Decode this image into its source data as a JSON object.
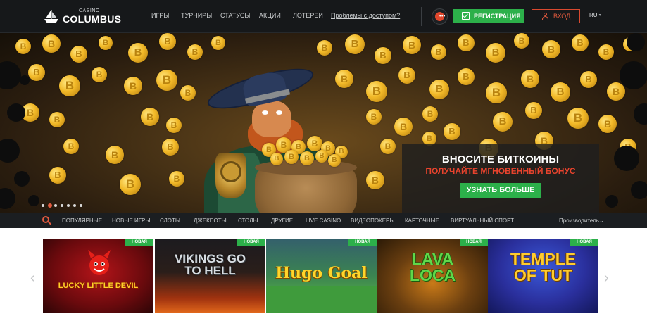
{
  "header": {
    "logo": {
      "small": "CASINO",
      "big": "COLUMBUS"
    },
    "nav": [
      {
        "label": "ИГРЫ"
      },
      {
        "label": "ТУРНИРЫ"
      },
      {
        "label": "СТАТУСЫ"
      },
      {
        "label": "АКЦИИ"
      },
      {
        "label": "ЛОТЕРЕИ"
      }
    ],
    "problem_link": "Проблемы с доступом?",
    "register_label": "РЕГИСТРАЦИЯ",
    "login_label": "ВХОД",
    "language": "RU"
  },
  "banner": {
    "promo_title": "ВНОСИТЕ БИТКОИНЫ",
    "promo_subtitle": "ПОЛУЧАЙТЕ МГНОВЕННЫЙ БОНУС",
    "promo_button": "УЗНАТЬ БОЛЬШЕ",
    "slide_count": 7,
    "active_slide": 2
  },
  "categories": {
    "items": [
      {
        "label": "ПОПУЛЯРНЫЕ"
      },
      {
        "label": "НОВЫЕ ИГРЫ"
      },
      {
        "label": "СЛОТЫ"
      },
      {
        "label": "ДЖЕКПОТЫ"
      },
      {
        "label": "СТОЛЫ"
      },
      {
        "label": "ДРУГИЕ"
      },
      {
        "label": "LIVE CASINO"
      },
      {
        "label": "ВИДЕОПОКЕРЫ"
      },
      {
        "label": "КАРТОЧНЫЕ"
      },
      {
        "label": "ВИРТУАЛЬНЫЙ СПОРТ"
      }
    ],
    "provider_label": "Производитель"
  },
  "games": [
    {
      "title": "LUCKY LITTLE DEVIL",
      "badge": "НОВАЯ"
    },
    {
      "title": "VIKINGS GO TO HELL",
      "badge": "НОВАЯ"
    },
    {
      "title": "Hugo Goal",
      "badge": "НОВАЯ"
    },
    {
      "title": "LAVA LOCA",
      "badge": "НОВАЯ"
    },
    {
      "title": "TEMPLE OF TUT",
      "badge": "НОВАЯ"
    }
  ],
  "colors": {
    "accent_green": "#2cb04a",
    "accent_red": "#e25a3e",
    "header_bg": "#16181a"
  }
}
